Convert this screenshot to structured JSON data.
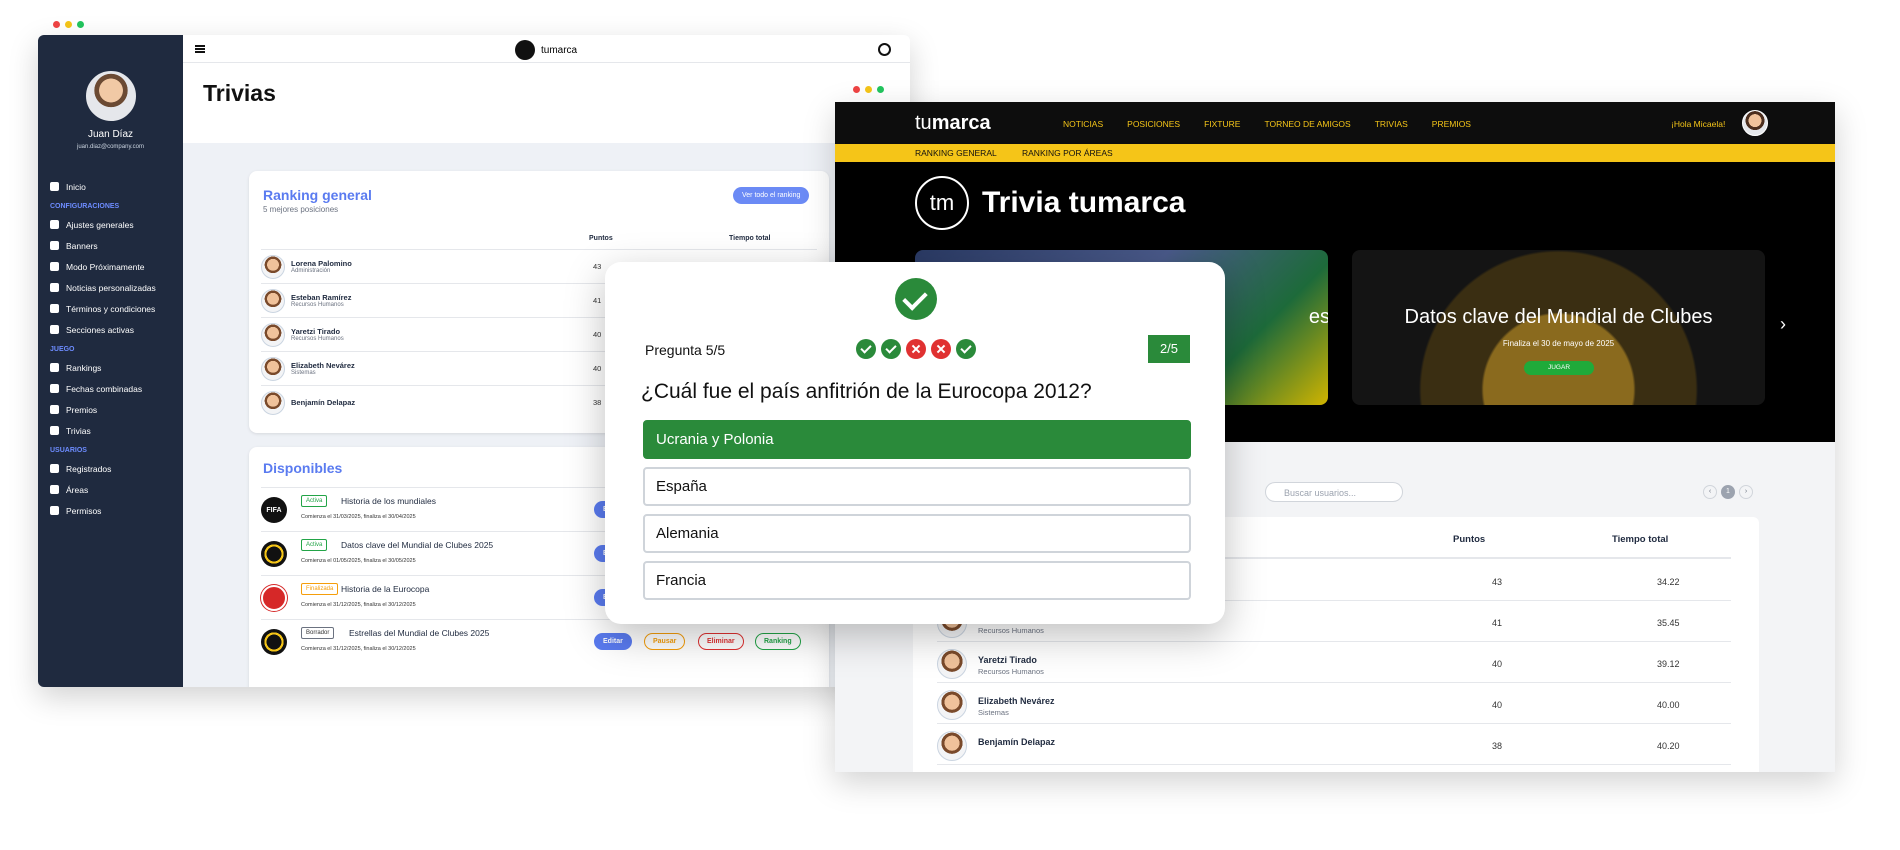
{
  "admin": {
    "user": {
      "name": "Juan Díaz",
      "email": "juan.diaz@company.com"
    },
    "nav": [
      {
        "type": "item",
        "label": "Inicio",
        "icon": "home-icon"
      },
      {
        "type": "section",
        "label": "CONFIGURACIONES"
      },
      {
        "type": "item",
        "label": "Ajustes generales",
        "icon": "gear-icon"
      },
      {
        "type": "item",
        "label": "Banners",
        "icon": "camera-icon"
      },
      {
        "type": "item",
        "label": "Modo Próximamente",
        "icon": "clock-icon"
      },
      {
        "type": "item",
        "label": "Noticias personalizadas",
        "icon": "newspaper-icon"
      },
      {
        "type": "item",
        "label": "Términos y condiciones",
        "icon": "gavel-icon"
      },
      {
        "type": "item",
        "label": "Secciones activas",
        "icon": "eye-icon"
      },
      {
        "type": "section",
        "label": "JUEGO"
      },
      {
        "type": "item",
        "label": "Rankings",
        "icon": "trophy-icon"
      },
      {
        "type": "item",
        "label": "Fechas combinadas",
        "icon": "merge-icon"
      },
      {
        "type": "item",
        "label": "Premios",
        "icon": "star-icon"
      },
      {
        "type": "item",
        "label": "Trivias",
        "icon": "copy-icon"
      },
      {
        "type": "section",
        "label": "USUARIOS"
      },
      {
        "type": "item",
        "label": "Registrados",
        "icon": "user-icon"
      },
      {
        "type": "item",
        "label": "Áreas",
        "icon": "building-icon"
      },
      {
        "type": "item",
        "label": "Permisos",
        "icon": "lock-icon"
      }
    ],
    "brand": "tumarca",
    "title": "Trivias",
    "ranking": {
      "title": "Ranking general",
      "subtitle": "5 mejores posiciones",
      "button": "Ver todo el ranking",
      "col_points": "Puntos",
      "col_time": "Tiempo total",
      "rows": [
        {
          "name": "Lorena Palomino",
          "area": "Administración",
          "points": "43"
        },
        {
          "name": "Esteban Ramírez",
          "area": "Recursos Humanos",
          "points": "41"
        },
        {
          "name": "Yaretzi Tirado",
          "area": "Recursos Humanos",
          "points": "40"
        },
        {
          "name": "Elizabeth Nevárez",
          "area": "Sistemas",
          "points": "40"
        },
        {
          "name": "Benjamín Delapaz",
          "area": "",
          "points": "38"
        }
      ]
    },
    "disponibles": {
      "title": "Disponibles",
      "rows": [
        {
          "logo": "FIFA",
          "status": "Activa",
          "name": "Historia de los mundiales",
          "dates": "Comienza el 31/03/2025, finaliza el 30/04/2025"
        },
        {
          "logo": "",
          "status": "Activa",
          "name": "Datos clave del Mundial de Clubes 2025",
          "dates": "Comienza el 01/05/2025, finaliza el 30/05/2025"
        },
        {
          "logo": "",
          "status": "Finalizada",
          "name": "Historia de la Eurocopa",
          "dates": "Comienza el 31/12/2025, finaliza el 30/12/2025"
        },
        {
          "logo": "",
          "status": "Borrador",
          "name": "Estrellas del Mundial de Clubes 2025",
          "dates": "Comienza el 31/12/2025, finaliza el 30/12/2025"
        }
      ],
      "actions": {
        "edit": "Editar",
        "pause": "Pausar",
        "delete": "Eliminar",
        "ranking": "Ranking"
      }
    }
  },
  "public": {
    "logo_light": "tu",
    "logo_bold": "marca",
    "nav": [
      "NOTICIAS",
      "POSICIONES",
      "FIXTURE",
      "TORNEO DE AMIGOS",
      "TRIVIAS",
      "PREMIOS"
    ],
    "greeting": "¡Hola Micaela!",
    "subnav": [
      "RANKING GENERAL",
      "RANKING POR ÁREAS"
    ],
    "hero_logo": "tm",
    "hero_title": "Trivia tumarca",
    "slide1_partial": "es",
    "slide2": {
      "title": "Datos clave del Mundial de Clubes",
      "subtitle": "Finaliza el 30 de mayo de 2025",
      "button": "JUGAR"
    },
    "search_placeholder": "Buscar usuarios...",
    "page": "1",
    "col_points": "Puntos",
    "col_time": "Tiempo total",
    "rows": [
      {
        "name": "",
        "area": "",
        "points": "43",
        "time": "34.22"
      },
      {
        "name": "",
        "area": "Recursos Humanos",
        "points": "41",
        "time": "35.45"
      },
      {
        "name": "Yaretzi Tirado",
        "area": "Recursos Humanos",
        "points": "40",
        "time": "39.12"
      },
      {
        "name": "Elizabeth Nevárez",
        "area": "Sistemas",
        "points": "40",
        "time": "40.00"
      },
      {
        "name": "Benjamín Delapaz",
        "area": "",
        "points": "38",
        "time": "40.20"
      }
    ]
  },
  "quiz": {
    "counter": "Pregunta 5/5",
    "results": [
      "correct",
      "correct",
      "wrong",
      "wrong",
      "correct"
    ],
    "score": "2/5",
    "question": "¿Cuál fue el país anfitrión de la Eurocopa 2012?",
    "options": [
      "Ucrania y Polonia",
      "España",
      "Alemania",
      "Francia"
    ],
    "correct_index": 0
  },
  "colors": {
    "accent": "#5a7bf0",
    "brand_yellow": "#f5c518",
    "correct": "#2a8a3a",
    "wrong": "#e03131",
    "sidebar": "#1f2a3f"
  }
}
